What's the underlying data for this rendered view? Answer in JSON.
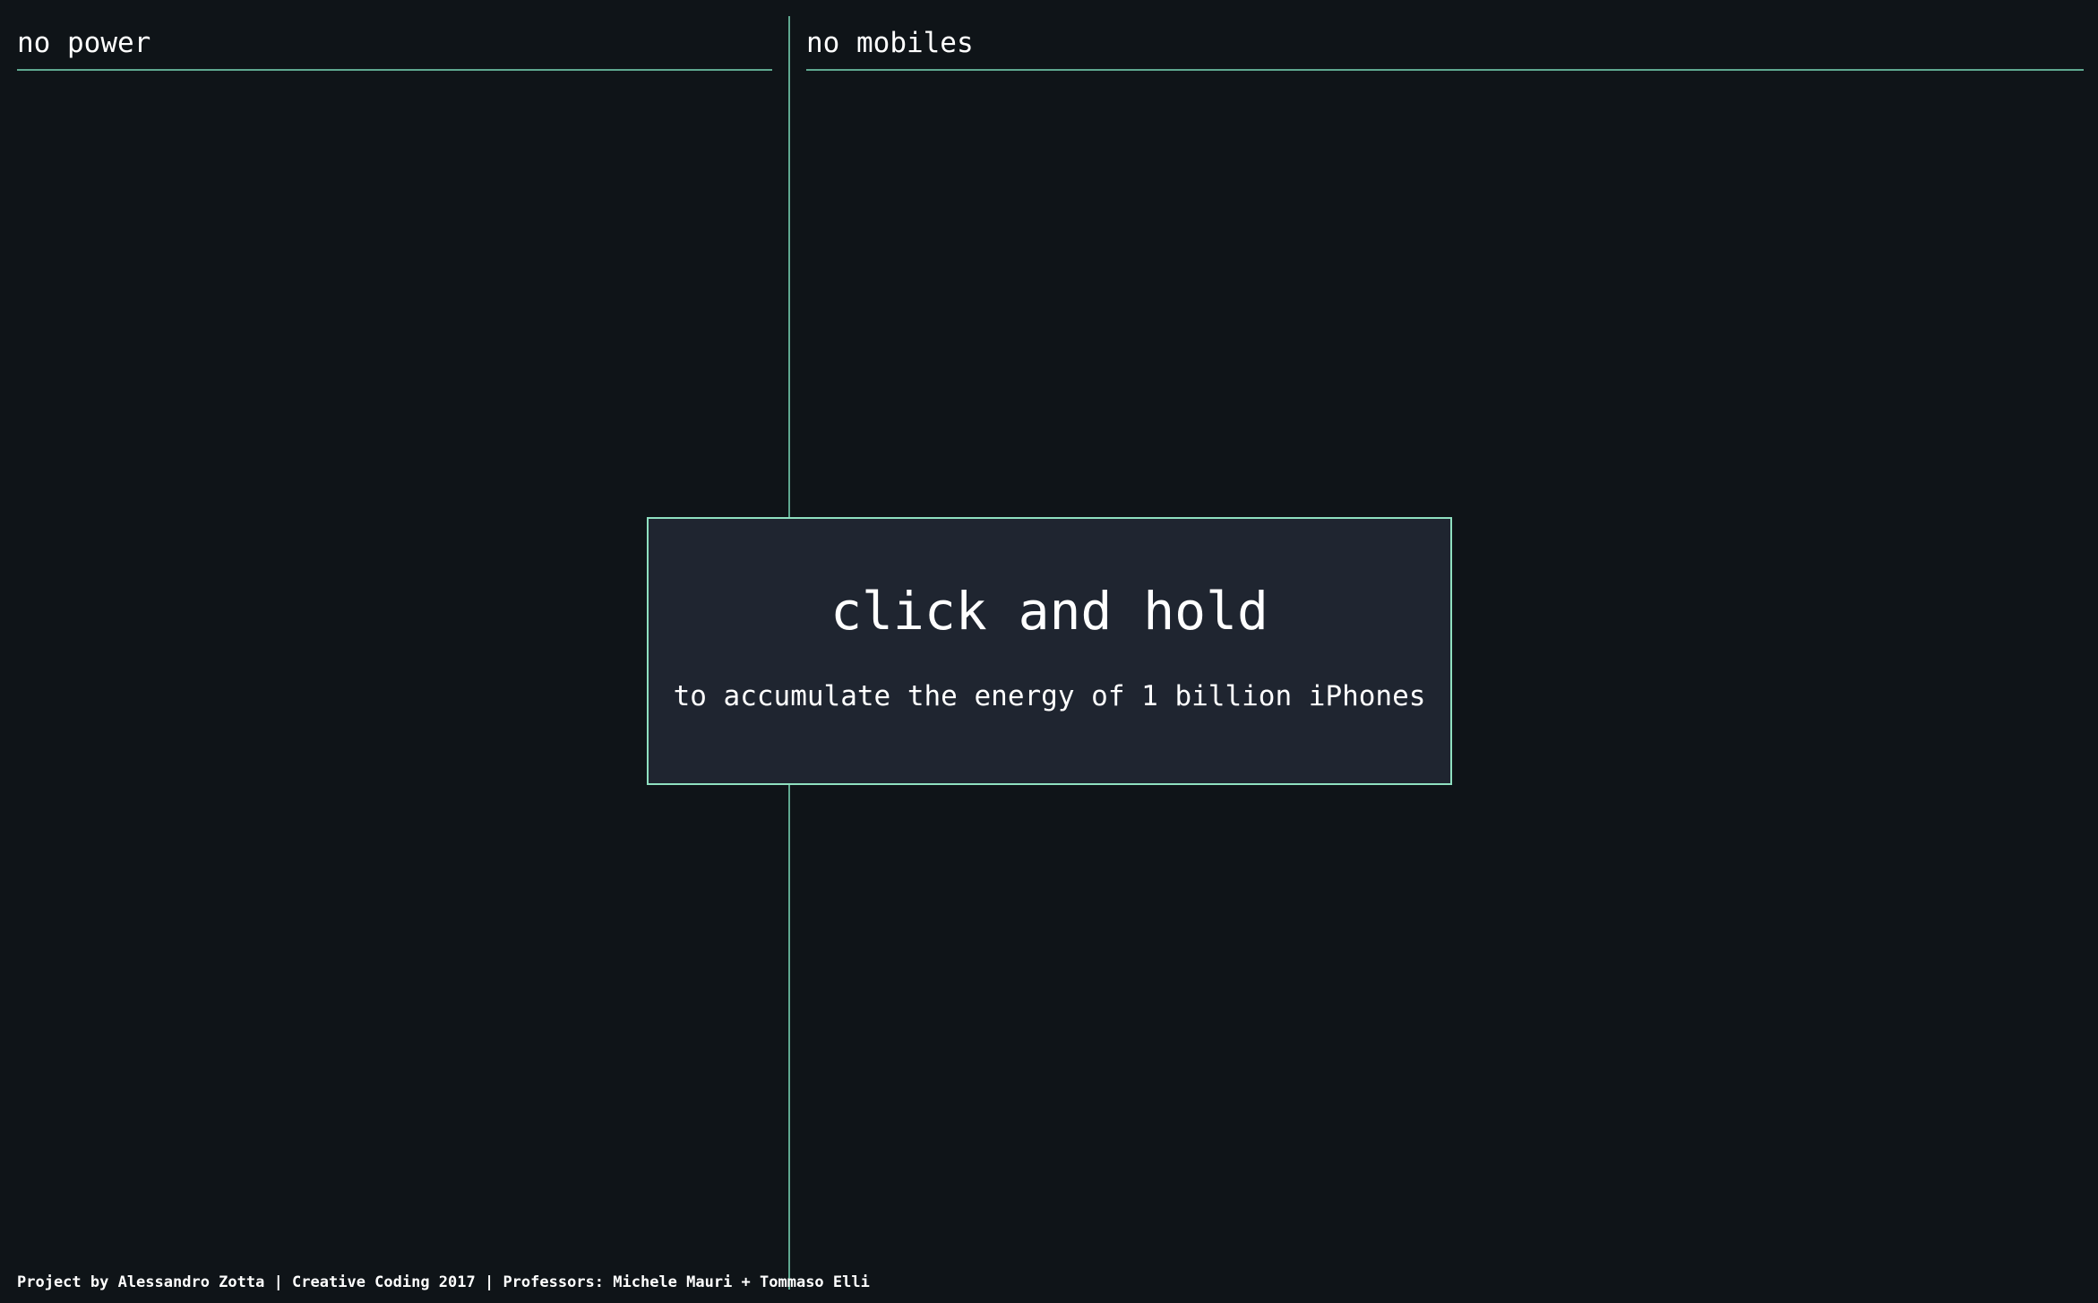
{
  "left_panel": {
    "title": "no power"
  },
  "right_panel": {
    "title": "no mobiles"
  },
  "overlay": {
    "title": "click and hold",
    "subtitle": "to accumulate the energy of 1 billion iPhones"
  },
  "footer": {
    "credits": "Project by Alessandro Zotta | Creative Coding 2017 | Professors: Michele Mauri + Tommaso Elli"
  },
  "colors": {
    "background": "#0f1418",
    "overlay_background": "#1f2530",
    "accent_line": "#5fa890",
    "overlay_border": "#8fe0c0",
    "text": "#ffffff"
  }
}
